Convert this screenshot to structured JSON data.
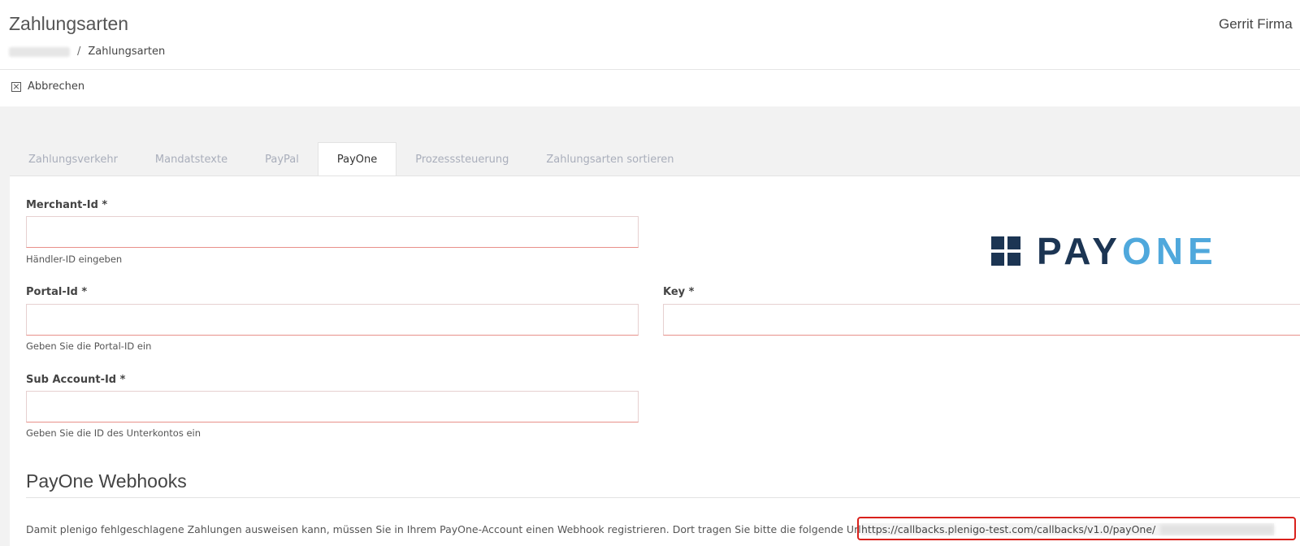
{
  "header": {
    "title": "Zahlungsarten",
    "user_name": "Gerrit Firma",
    "breadcrumb_current": "Zahlungsarten",
    "breadcrumb_separator": "/"
  },
  "toolbar": {
    "cancel_label": "Abbrechen"
  },
  "tabs": [
    {
      "label": "Zahlungsverkehr"
    },
    {
      "label": "Mandatstexte"
    },
    {
      "label": "PayPal"
    },
    {
      "label": "PayOne"
    },
    {
      "label": "Prozesssteuerung"
    },
    {
      "label": "Zahlungsarten sortieren"
    }
  ],
  "active_tab": "PayOne",
  "form": {
    "merchant_id": {
      "label": "Merchant-Id *",
      "value": "",
      "help": "Händler-ID eingeben"
    },
    "portal_id": {
      "label": "Portal-Id *",
      "value": "",
      "help": "Geben Sie die Portal-ID ein"
    },
    "key": {
      "label": "Key *",
      "value": ""
    },
    "sub_account_id": {
      "label": "Sub Account-Id *",
      "value": "",
      "help": "Geben Sie die ID des Unterkontos ein"
    }
  },
  "logo": {
    "text_dark": "PAY",
    "text_light": "ONE",
    "color_dark": "#1c3553",
    "color_light": "#4fa8dc"
  },
  "webhooks": {
    "title": "PayOne Webhooks",
    "description": "Damit plenigo fehlgeschlagene Zahlungen ausweisen kann, müssen Sie in Ihrem PayOne-Account einen Webhook registrieren. Dort tragen Sie bitte die folgende Url ein",
    "url": "https://callbacks.plenigo-test.com/callbacks/v1.0/payOne/",
    "highlight_color": "#d9211c"
  }
}
